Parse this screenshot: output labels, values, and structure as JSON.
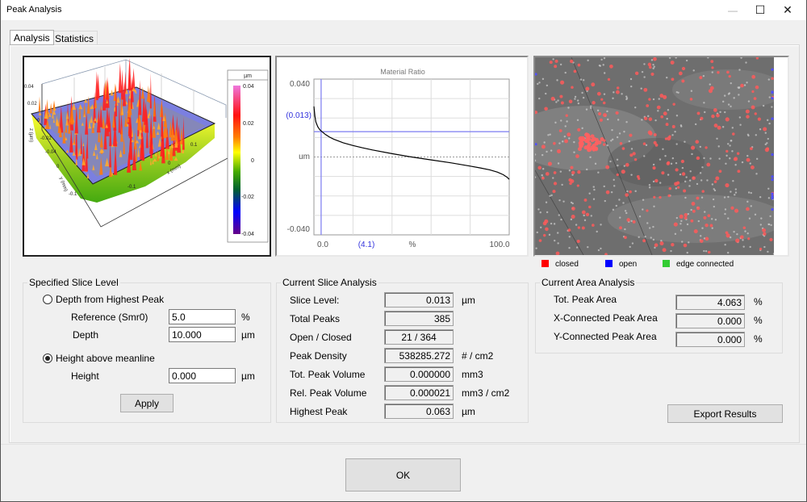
{
  "window": {
    "title": "Peak Analysis",
    "controls": {
      "minimize": "—",
      "maximize": "☐",
      "close": "✕"
    }
  },
  "tabs": [
    {
      "label": "Analysis",
      "active": true
    },
    {
      "label": "Statistics",
      "active": false
    }
  ],
  "surface_plot": {
    "colorbar": {
      "unit": "µm",
      "ticks": [
        "0.04",
        "0.02",
        "0",
        "-0.02",
        "-0.04"
      ],
      "range": [
        -0.04,
        0.04
      ]
    },
    "z_axis": {
      "label": "z (µm)",
      "ticks": [
        "0.04",
        "0.02",
        "0",
        "-0.02",
        "-0.04"
      ]
    },
    "y_axis": {
      "label": "y (mm)",
      "ticks": [
        "0",
        "-0.1"
      ]
    },
    "x_axis": {
      "label": "x (mm)",
      "ticks": [
        "0.1",
        "0",
        "-0.1"
      ]
    },
    "slice_plane_level": 0.013
  },
  "chart_data": {
    "type": "line",
    "title": "Material Ratio",
    "xlabel": "%",
    "ylabel": "um",
    "xlim": [
      0,
      100
    ],
    "ylim": [
      -0.04,
      0.04
    ],
    "x_tick_labels": [
      "0.0",
      "100.0"
    ],
    "y_tick_labels": [
      "0.040",
      "-0.040"
    ],
    "grid": true,
    "marker_x": {
      "value": 4.1,
      "label": "(4.1)",
      "color": "#7b7bf0"
    },
    "marker_y": {
      "value": 0.013,
      "label": "(0.013)",
      "color": "#7b7bf0"
    },
    "midline": 0,
    "series": [
      {
        "name": "Material Ratio curve",
        "color": "#000000",
        "x": [
          0,
          0.5,
          1,
          2,
          3,
          4.1,
          6,
          8,
          10,
          15,
          20,
          25,
          30,
          40,
          50,
          60,
          70,
          80,
          85,
          90,
          94,
          97,
          99,
          100
        ],
        "y": [
          0.026,
          0.021,
          0.018,
          0.0155,
          0.014,
          0.013,
          0.0115,
          0.0102,
          0.0092,
          0.0073,
          0.0059,
          0.0047,
          0.0036,
          0.0017,
          0.0,
          -0.0015,
          -0.003,
          -0.0047,
          -0.0056,
          -0.0066,
          -0.0078,
          -0.0091,
          -0.0105,
          -0.0115
        ]
      }
    ]
  },
  "image_legend": [
    {
      "label": "closed",
      "color": "#ff0000"
    },
    {
      "label": "open",
      "color": "#0000ff"
    },
    {
      "label": "edge connected",
      "color": "#33cc33"
    }
  ],
  "specified_slice_level": {
    "title": "Specified Slice Level",
    "option_depth": {
      "label": "Depth from Highest Peak",
      "checked": false
    },
    "reference": {
      "label": "Reference (Smr0)",
      "value": "5.0",
      "unit": "%"
    },
    "depth": {
      "label": "Depth",
      "value": "10.000",
      "unit": "µm"
    },
    "option_height": {
      "label": "Height above meanline",
      "checked": true
    },
    "height": {
      "label": "Height",
      "value": "0.000",
      "unit": "µm"
    },
    "apply_label": "Apply"
  },
  "current_slice_analysis": {
    "title": "Current Slice Analysis",
    "rows": [
      {
        "label": "Slice Level:",
        "value": "0.013",
        "unit": "µm"
      },
      {
        "label": "Total Peaks",
        "value": "385",
        "unit": ""
      },
      {
        "label": "Open / Closed",
        "value": "21  /  364",
        "unit": ""
      },
      {
        "label": "Peak Density",
        "value": "538285.272",
        "unit": "# / cm2"
      },
      {
        "label": "Tot. Peak Volume",
        "value": "0.000000",
        "unit": "mm3"
      },
      {
        "label": "Rel. Peak Volume",
        "value": "0.000021",
        "unit": "mm3 / cm2"
      },
      {
        "label": "Highest Peak",
        "value": "0.063",
        "unit": "µm"
      }
    ]
  },
  "current_area_analysis": {
    "title": "Current Area Analysis",
    "rows": [
      {
        "label": "Tot. Peak Area",
        "value": "4.063",
        "unit": "%"
      },
      {
        "label": "X-Connected Peak Area",
        "value": "0.000",
        "unit": "%"
      },
      {
        "label": "Y-Connected Peak Area",
        "value": "0.000",
        "unit": "%"
      }
    ]
  },
  "export_label": "Export Results",
  "ok_label": "OK"
}
